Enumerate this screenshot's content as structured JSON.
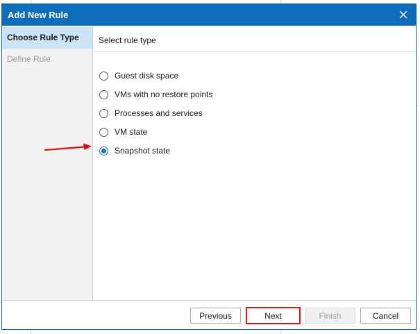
{
  "dialog": {
    "title": "Add New Rule"
  },
  "sidebar": {
    "steps": [
      {
        "label": "Choose Rule Type",
        "active": true
      },
      {
        "label": "Define Rule",
        "active": false
      }
    ]
  },
  "content": {
    "header": "Select rule type",
    "options": [
      {
        "label": "Guest disk space",
        "checked": false
      },
      {
        "label": "VMs with no restore points",
        "checked": false
      },
      {
        "label": "Processes and services",
        "checked": false
      },
      {
        "label": "VM state",
        "checked": false
      },
      {
        "label": "Snapshot state",
        "checked": true
      }
    ]
  },
  "footer": {
    "previous_label": "Previous",
    "next_label": "Next",
    "finish_label": "Finish",
    "cancel_label": "Cancel"
  },
  "colors": {
    "titlebar": "#0e6cb8",
    "active_step": "#cde4f7",
    "radio_checked": "#1e73be",
    "annotation_red": "#e01010"
  },
  "icons": {
    "close": "close-icon",
    "annotation": "red-arrow-icon"
  }
}
